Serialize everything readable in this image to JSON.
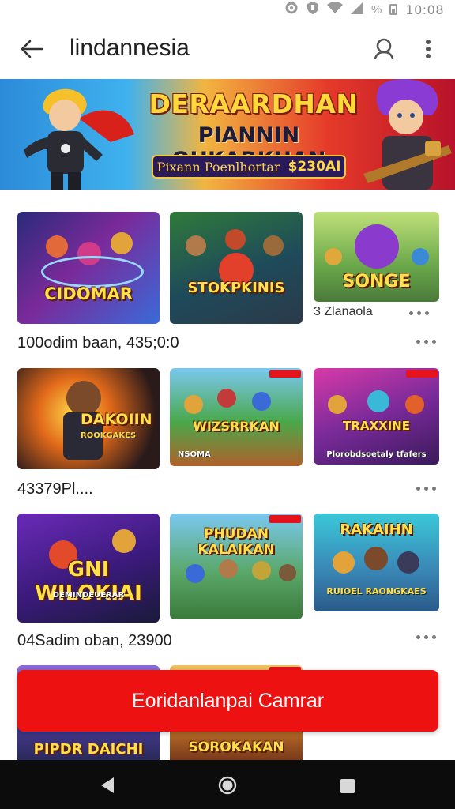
{
  "status_bar": {
    "time": "10:08",
    "signal_text": "%",
    "icons": [
      "settings-icon",
      "shield-icon",
      "wifi-icon",
      "signal-icon",
      "battery-icon"
    ]
  },
  "app_bar": {
    "title": "lindannesia",
    "back_icon": "arrow-left-icon",
    "search_icon": "search-icon",
    "more_icon": "more-vertical-icon"
  },
  "banner": {
    "title": "DERAARDHAN",
    "subtitle": "PIANNIN OHKARKHAN",
    "pill_text": "Pixann Poenlhortar",
    "pill_price": "$230AI"
  },
  "games": [
    {
      "caption": "CIDOMAR",
      "sub": ""
    },
    {
      "caption": "STOKPKINIS",
      "sub": ""
    },
    {
      "caption": "SONGE",
      "sub": ""
    },
    {
      "caption": "DAKOIIN",
      "sub": "ROOKGAKES"
    },
    {
      "caption": "WIZSRRKAN",
      "sub": "NSOMA"
    },
    {
      "caption": "TRAXXINE",
      "sub": "Plorobdsoetaly tfafers"
    },
    {
      "caption": "GNI WILOKIAI",
      "sub": "DEMINDEUERAR"
    },
    {
      "caption": "PHUDAN KALAIKAN",
      "sub": ""
    },
    {
      "caption": "RAKAIHN",
      "sub": "RUIOEL RAONGKAES"
    },
    {
      "caption": "PIPDR DAICHI",
      "sub": ""
    },
    {
      "caption": "SOROKAKAN",
      "sub": ""
    }
  ],
  "rows": {
    "row1_caption_small": "3 Zlanaola",
    "row1_text": "100odim baan, 435;0:0",
    "row2_text": "43379Pl....",
    "row3_text": "04Sadim oban, 23900"
  },
  "cta": {
    "label": "Eoridanlanpai Camrar"
  },
  "nav": {
    "back_icon": "nav-back-icon",
    "home_icon": "nav-home-icon",
    "recent_icon": "nav-recent-icon"
  }
}
